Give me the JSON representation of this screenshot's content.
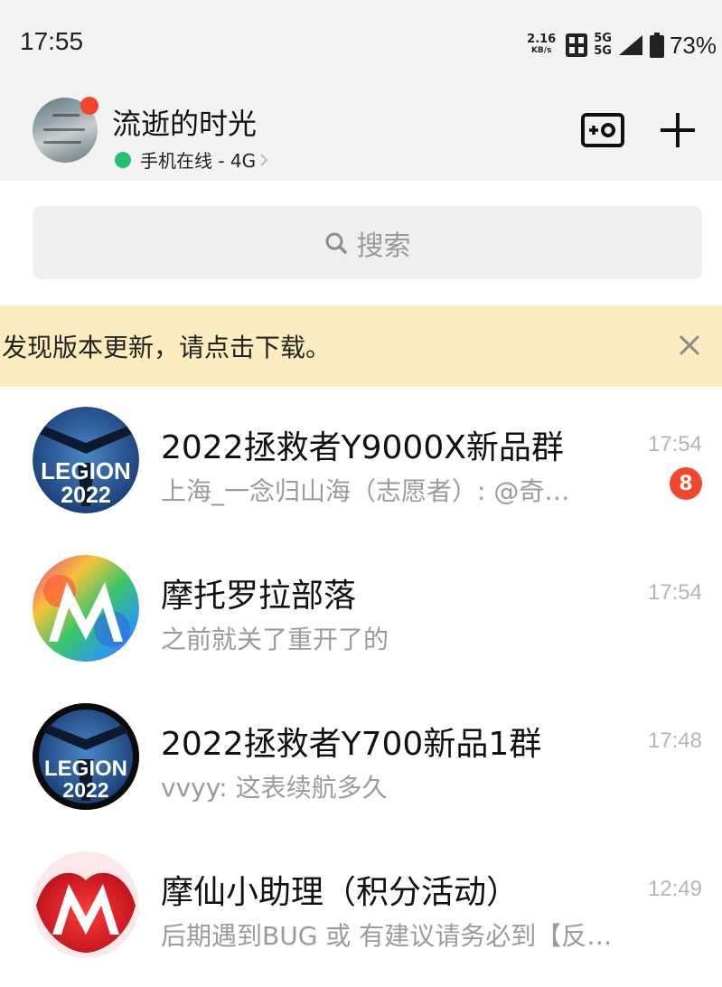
{
  "status_bar": {
    "time": "17:55",
    "net_speed": "2.16",
    "net_unit": "KB/s",
    "net_type_1": "5G",
    "net_type_2": "5G",
    "battery": "73%"
  },
  "header": {
    "nickname": "流逝的时光",
    "online_status": "手机在线 - 4G"
  },
  "search": {
    "placeholder": "搜索"
  },
  "banner": {
    "text": "发现版本更新，请点击下载。"
  },
  "chats": [
    {
      "title": "2022拯救者Y9000X新品群",
      "preview": "上海_一念归山海（志愿者）: @奇…",
      "time": "17:54",
      "unread": "8",
      "avatar_text_1": "LEGION",
      "avatar_text_2": "2022"
    },
    {
      "title": "摩托罗拉部落",
      "preview": "之前就关了重开了的",
      "time": "17:54"
    },
    {
      "title": "2022拯救者Y700新品1群",
      "preview": "vvyy: 这表续航多久",
      "time": "17:48",
      "avatar_text_1": "LEGION",
      "avatar_text_2": "2022"
    },
    {
      "title": "摩仙小助理（积分活动）",
      "preview": "后期遇到BUG 或 有建议请务必到【反馈…",
      "time": "12:49"
    }
  ],
  "colors": {
    "accent_red": "#f2472d",
    "online_green": "#21c36b",
    "banner_bg": "#fbedbd"
  }
}
